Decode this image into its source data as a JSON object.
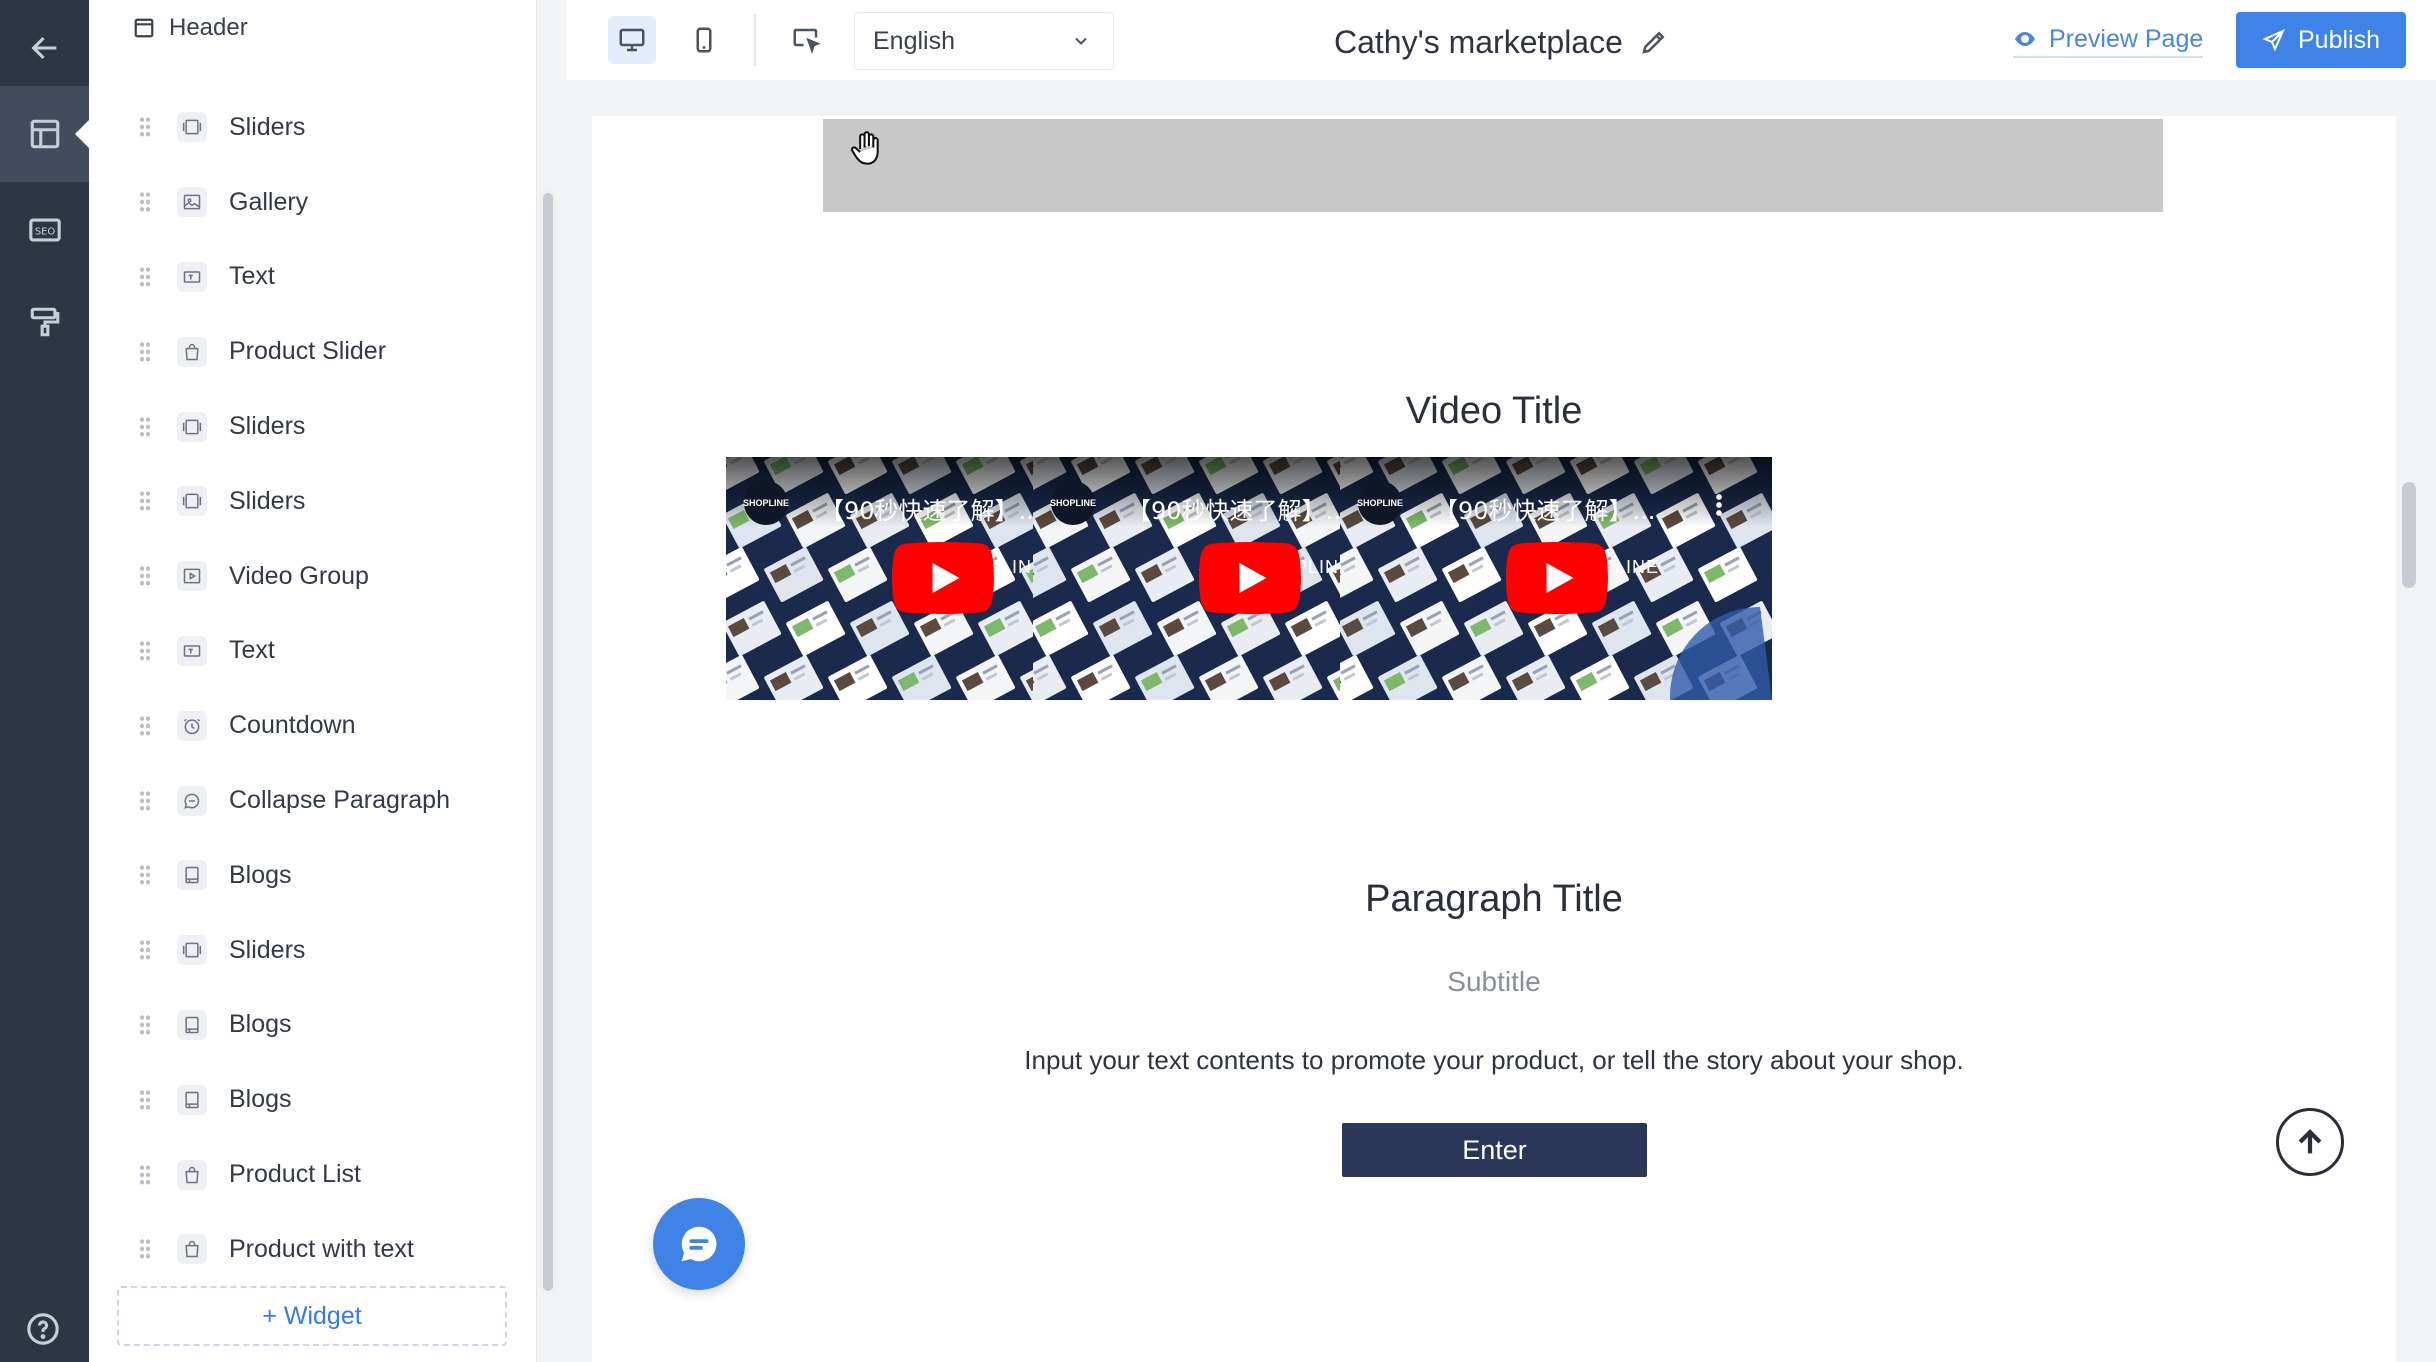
{
  "rail": {
    "items": [
      {
        "icon": "back-arrow-icon"
      },
      {
        "icon": "layout-icon",
        "active": true
      },
      {
        "icon": "seo-icon",
        "label": "SEO"
      },
      {
        "icon": "paint-roller-icon"
      }
    ],
    "help_icon": "question-circle-icon"
  },
  "panel": {
    "header_label": "Header",
    "widgets": [
      {
        "label": "Sliders",
        "icon": "slider-icon"
      },
      {
        "label": "Gallery",
        "icon": "image-icon"
      },
      {
        "label": "Text",
        "icon": "text-icon"
      },
      {
        "label": "Product Slider",
        "icon": "bag-icon"
      },
      {
        "label": "Sliders",
        "icon": "slider-icon"
      },
      {
        "label": "Sliders",
        "icon": "slider-icon"
      },
      {
        "label": "Video Group",
        "icon": "video-icon"
      },
      {
        "label": "Text",
        "icon": "text-icon"
      },
      {
        "label": "Countdown",
        "icon": "clock-icon"
      },
      {
        "label": "Collapse Paragraph",
        "icon": "chat-bubble-icon"
      },
      {
        "label": "Blogs",
        "icon": "book-icon"
      },
      {
        "label": "Sliders",
        "icon": "slider-icon"
      },
      {
        "label": "Blogs",
        "icon": "book-icon"
      },
      {
        "label": "Blogs",
        "icon": "book-icon"
      },
      {
        "label": "Product List",
        "icon": "bag-icon"
      },
      {
        "label": "Product with text",
        "icon": "bag-icon"
      }
    ],
    "add_widget_label": "+ Widget"
  },
  "toolbar": {
    "language": "English",
    "site_title": "Cathy's marketplace",
    "preview_label": "Preview Page",
    "publish_label": "Publish"
  },
  "canvas": {
    "video_section_title": "Video Title",
    "videos": [
      {
        "title": "【90秒快速了解】...",
        "logo": "SHOPLINE",
        "brand": "PLINE"
      },
      {
        "title": "【90秒快速了解】...",
        "logo": "SHOPLINE",
        "brand": "PLINE"
      },
      {
        "title": "【90秒快速了解】...",
        "logo": "SHOPLINE",
        "brand": "PLINE"
      }
    ],
    "paragraph_title": "Paragraph Title",
    "paragraph_subtitle": "Subtitle",
    "paragraph_body": "Input your text contents to promote your product, or tell the story about your shop.",
    "enter_label": "Enter"
  },
  "colors": {
    "rail_bg": "#2e3644",
    "accent": "#3f83e6",
    "enter_button": "#2c3659",
    "placeholder_block": "#c8c8c8"
  }
}
